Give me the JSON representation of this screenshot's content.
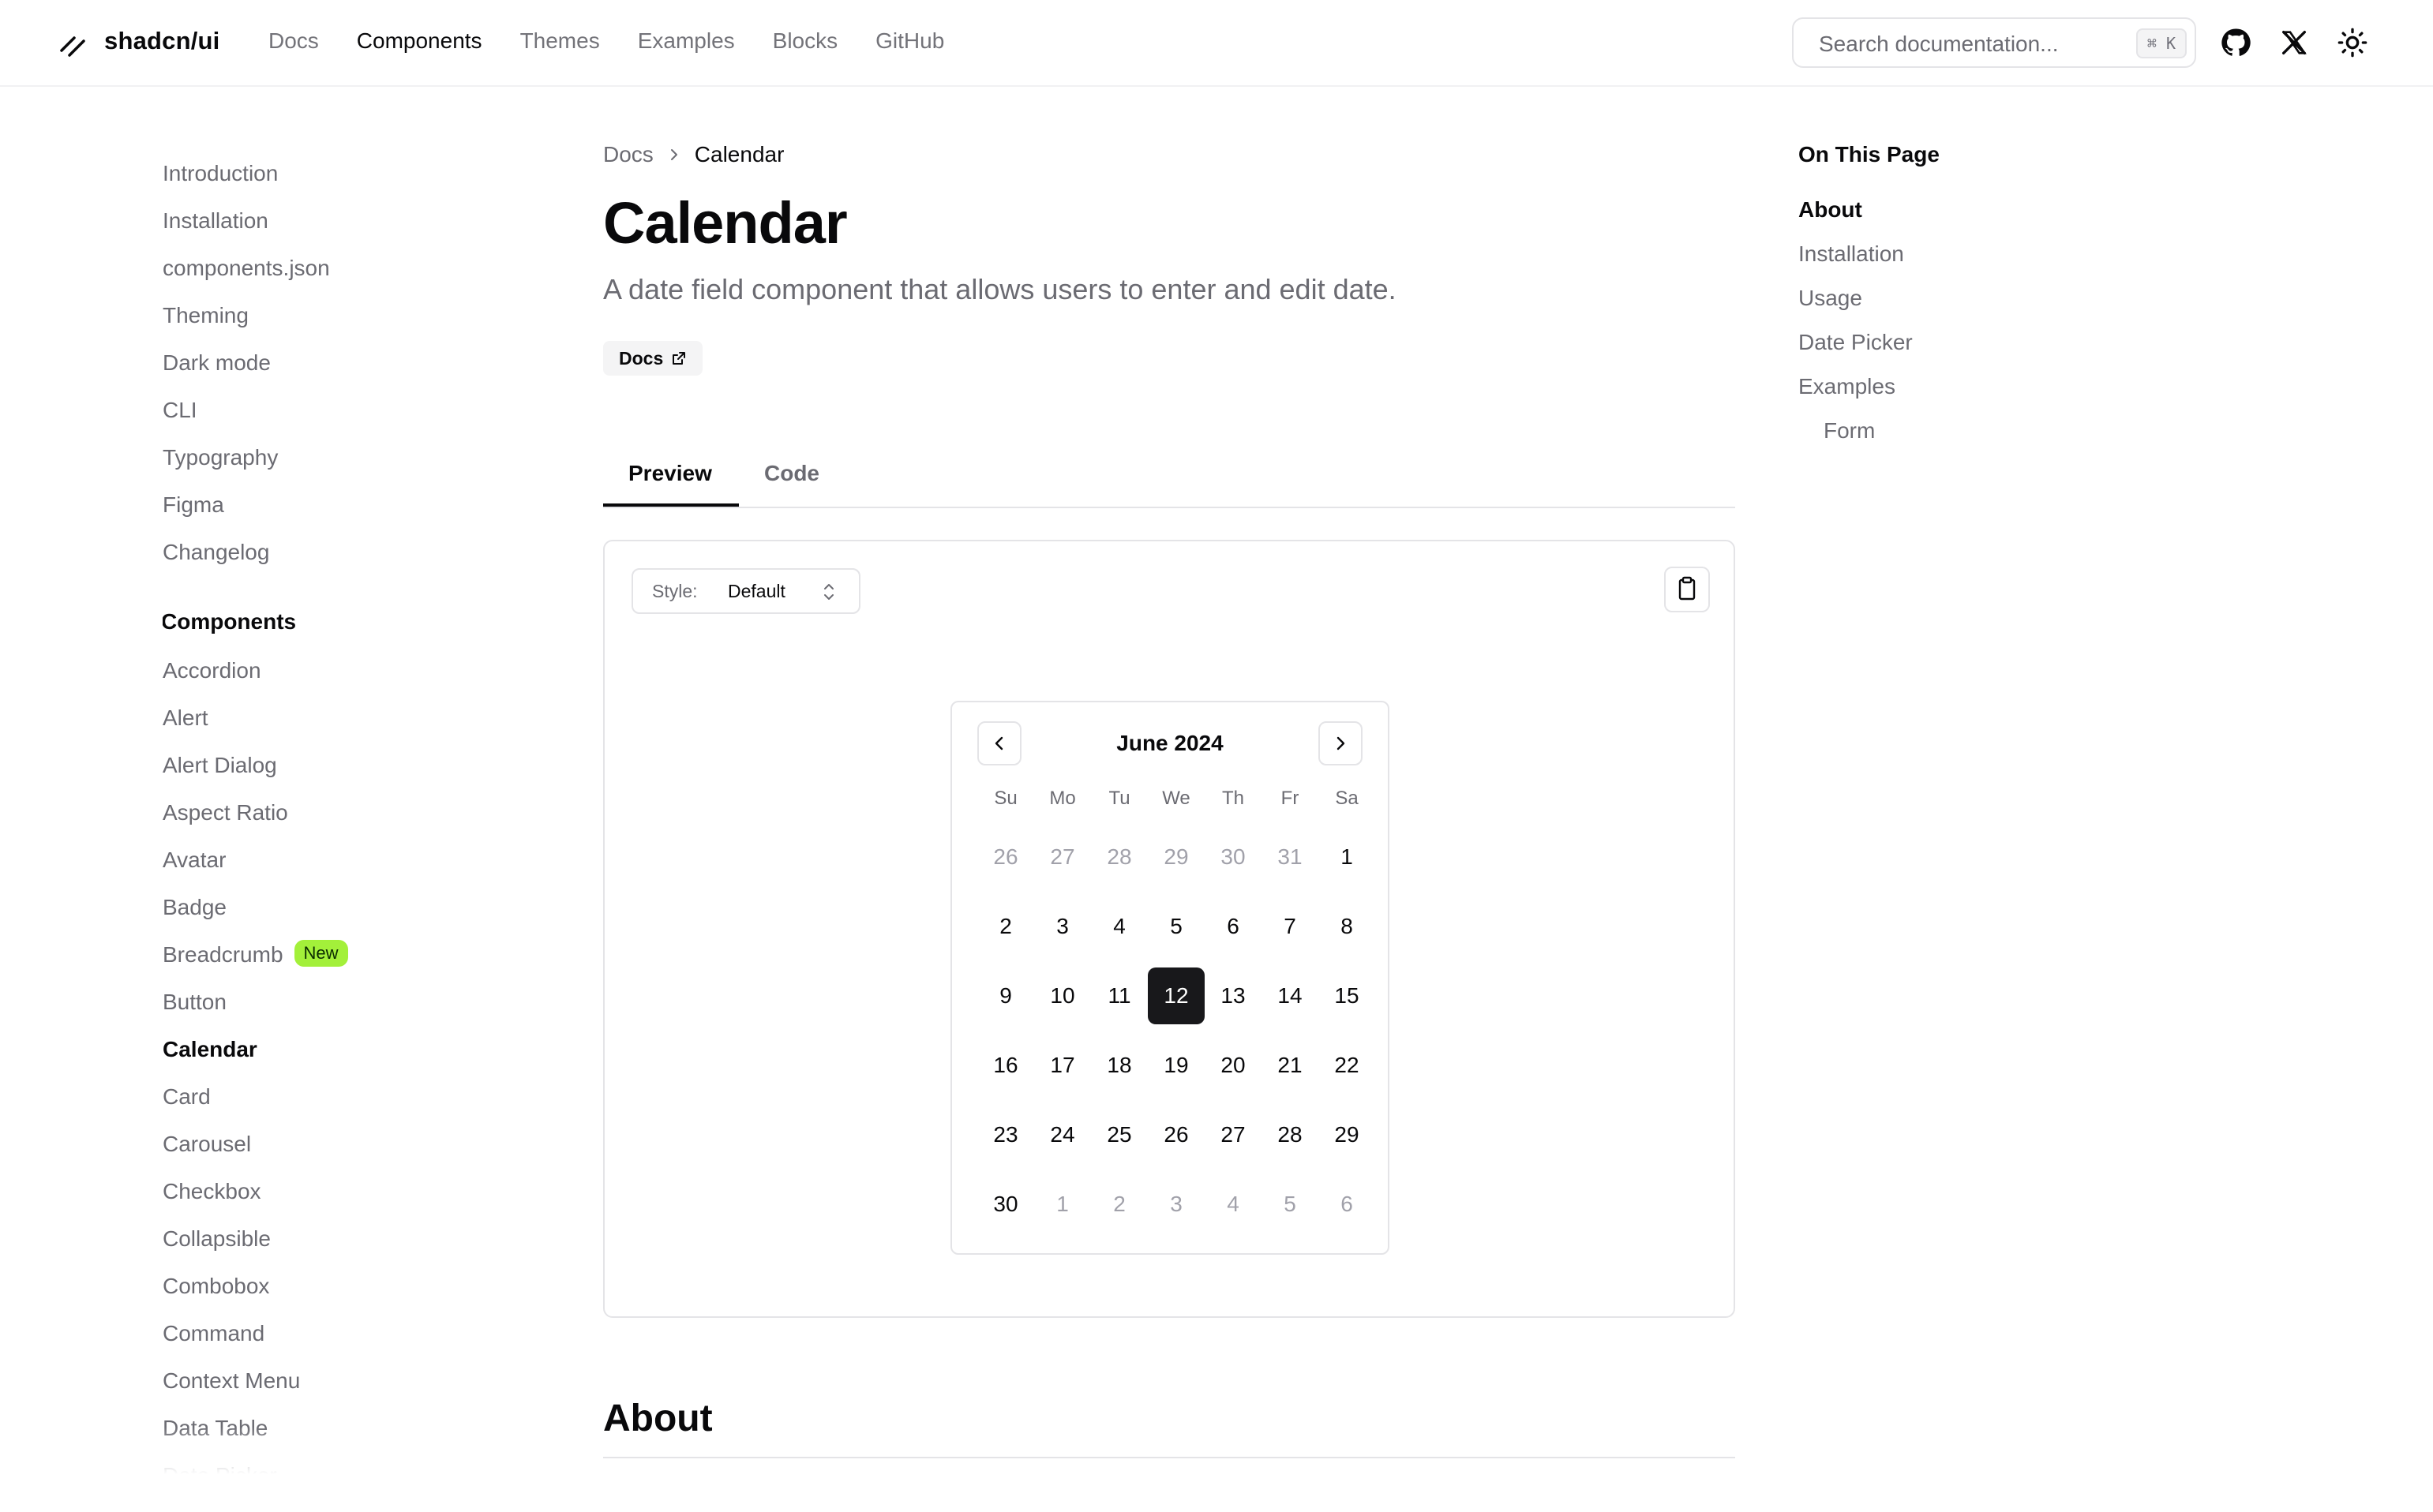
{
  "header": {
    "logo_text": "shadcn/ui",
    "nav": [
      {
        "label": "Docs",
        "active": false
      },
      {
        "label": "Components",
        "active": true
      },
      {
        "label": "Themes",
        "active": false
      },
      {
        "label": "Examples",
        "active": false
      },
      {
        "label": "Blocks",
        "active": false
      },
      {
        "label": "GitHub",
        "active": false
      }
    ],
    "search_placeholder": "Search documentation...",
    "search_shortcut": "⌘ K",
    "icons": [
      "github-icon",
      "x-icon",
      "sun-icon"
    ]
  },
  "sidebar": {
    "getting_started": [
      "Introduction",
      "Installation",
      "components.json",
      "Theming",
      "Dark mode",
      "CLI",
      "Typography",
      "Figma",
      "Changelog"
    ],
    "components_heading": "Components",
    "components": [
      {
        "label": "Accordion"
      },
      {
        "label": "Alert"
      },
      {
        "label": "Alert Dialog"
      },
      {
        "label": "Aspect Ratio"
      },
      {
        "label": "Avatar"
      },
      {
        "label": "Badge"
      },
      {
        "label": "Breadcrumb",
        "badge": "New"
      },
      {
        "label": "Button"
      },
      {
        "label": "Calendar",
        "active": true
      },
      {
        "label": "Card"
      },
      {
        "label": "Carousel"
      },
      {
        "label": "Checkbox"
      },
      {
        "label": "Collapsible"
      },
      {
        "label": "Combobox"
      },
      {
        "label": "Command"
      },
      {
        "label": "Context Menu"
      },
      {
        "label": "Data Table"
      },
      {
        "label": "Date Picker"
      }
    ]
  },
  "main": {
    "breadcrumb": {
      "root": "Docs",
      "current": "Calendar"
    },
    "title": "Calendar",
    "subtitle": "A date field component that allows users to enter and edit date.",
    "docs_badge": "Docs",
    "tabs": [
      {
        "label": "Preview",
        "active": true
      },
      {
        "label": "Code",
        "active": false
      }
    ],
    "style_select": {
      "label": "Style:",
      "value": "Default"
    },
    "about_heading": "About"
  },
  "calendar": {
    "month_label": "June 2024",
    "weekdays": [
      "Su",
      "Mo",
      "Tu",
      "We",
      "Th",
      "Fr",
      "Sa"
    ],
    "weeks": [
      [
        {
          "d": "26",
          "o": true
        },
        {
          "d": "27",
          "o": true
        },
        {
          "d": "28",
          "o": true
        },
        {
          "d": "29",
          "o": true
        },
        {
          "d": "30",
          "o": true
        },
        {
          "d": "31",
          "o": true
        },
        {
          "d": "1"
        }
      ],
      [
        {
          "d": "2"
        },
        {
          "d": "3"
        },
        {
          "d": "4"
        },
        {
          "d": "5"
        },
        {
          "d": "6"
        },
        {
          "d": "7"
        },
        {
          "d": "8"
        }
      ],
      [
        {
          "d": "9"
        },
        {
          "d": "10"
        },
        {
          "d": "11"
        },
        {
          "d": "12",
          "selected": true
        },
        {
          "d": "13"
        },
        {
          "d": "14"
        },
        {
          "d": "15"
        }
      ],
      [
        {
          "d": "16"
        },
        {
          "d": "17"
        },
        {
          "d": "18"
        },
        {
          "d": "19"
        },
        {
          "d": "20"
        },
        {
          "d": "21"
        },
        {
          "d": "22"
        }
      ],
      [
        {
          "d": "23"
        },
        {
          "d": "24"
        },
        {
          "d": "25"
        },
        {
          "d": "26"
        },
        {
          "d": "27"
        },
        {
          "d": "28"
        },
        {
          "d": "29"
        }
      ],
      [
        {
          "d": "30"
        },
        {
          "d": "1",
          "o": true
        },
        {
          "d": "2",
          "o": true
        },
        {
          "d": "3",
          "o": true
        },
        {
          "d": "4",
          "o": true
        },
        {
          "d": "5",
          "o": true
        },
        {
          "d": "6",
          "o": true
        }
      ]
    ]
  },
  "toc": {
    "title": "On This Page",
    "items": [
      {
        "label": "About",
        "active": true
      },
      {
        "label": "Installation"
      },
      {
        "label": "Usage"
      },
      {
        "label": "Date Picker"
      },
      {
        "label": "Examples"
      },
      {
        "label": "Form",
        "sub": true
      }
    ]
  },
  "colors": {
    "badge_new_bg": "#a3f03a",
    "selected_day_bg": "#18181b",
    "muted_text": "#6b6b72",
    "border": "#e4e4e7"
  }
}
